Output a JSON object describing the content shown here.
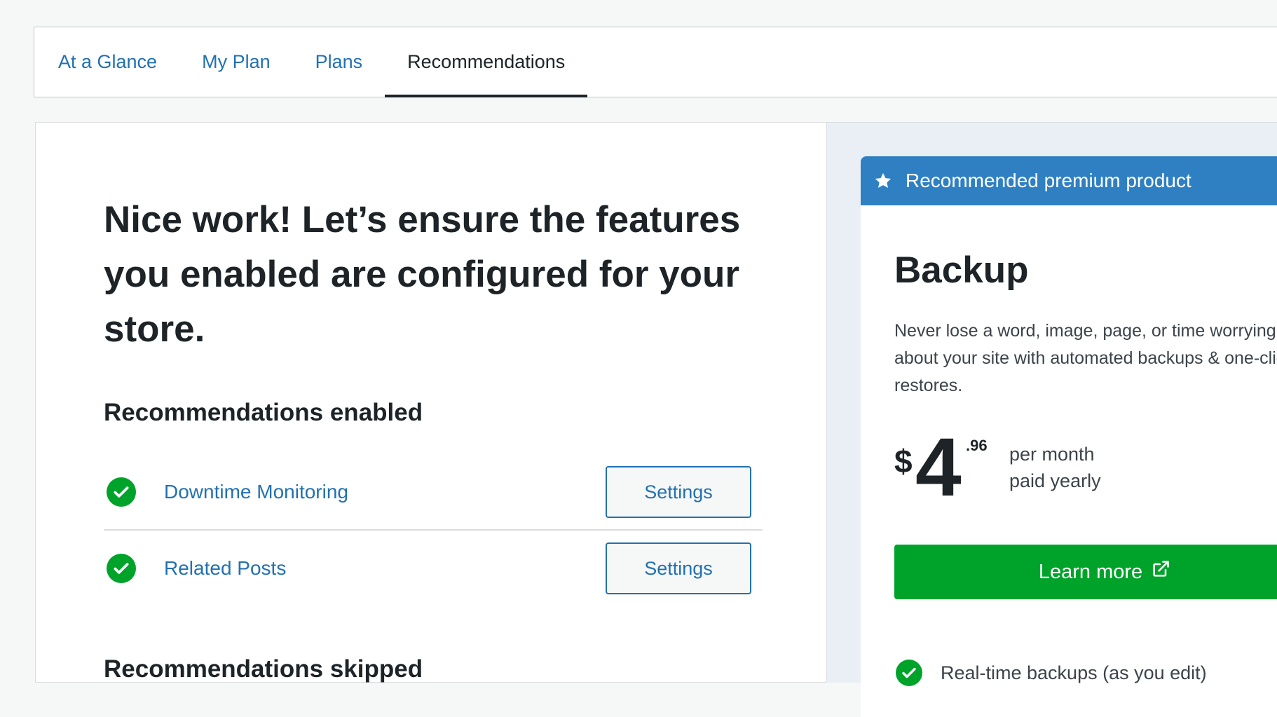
{
  "tabs": [
    {
      "label": "At a Glance"
    },
    {
      "label": "My Plan"
    },
    {
      "label": "Plans"
    },
    {
      "label": "Recommendations"
    }
  ],
  "main": {
    "headline": "Nice work! Let’s ensure the features you enabled are configured for your store.",
    "enabled_title": "Recommendations enabled",
    "enabled_items": [
      {
        "label": "Downtime Monitoring",
        "button": "Settings"
      },
      {
        "label": "Related Posts",
        "button": "Settings"
      }
    ],
    "skipped_title": "Recommendations skipped"
  },
  "promo": {
    "header": "Recommended premium product",
    "product": "Backup",
    "description_lines": [
      "Never lose a word, image, page, or time worrying",
      "about your site with automated backups & one-click",
      "restores."
    ],
    "price": {
      "currency": "$",
      "amount": "4",
      "cents": ".96",
      "term_line1": "per month",
      "term_line2": "paid yearly"
    },
    "cta": "Learn more",
    "features": [
      "Real-time backups (as you edit)"
    ]
  },
  "colors": {
    "link": "#2271b1",
    "success": "#00a32a",
    "promo_header": "#2f80c3"
  },
  "icons": [
    "star-icon",
    "check-circle-icon",
    "external-link-icon"
  ]
}
